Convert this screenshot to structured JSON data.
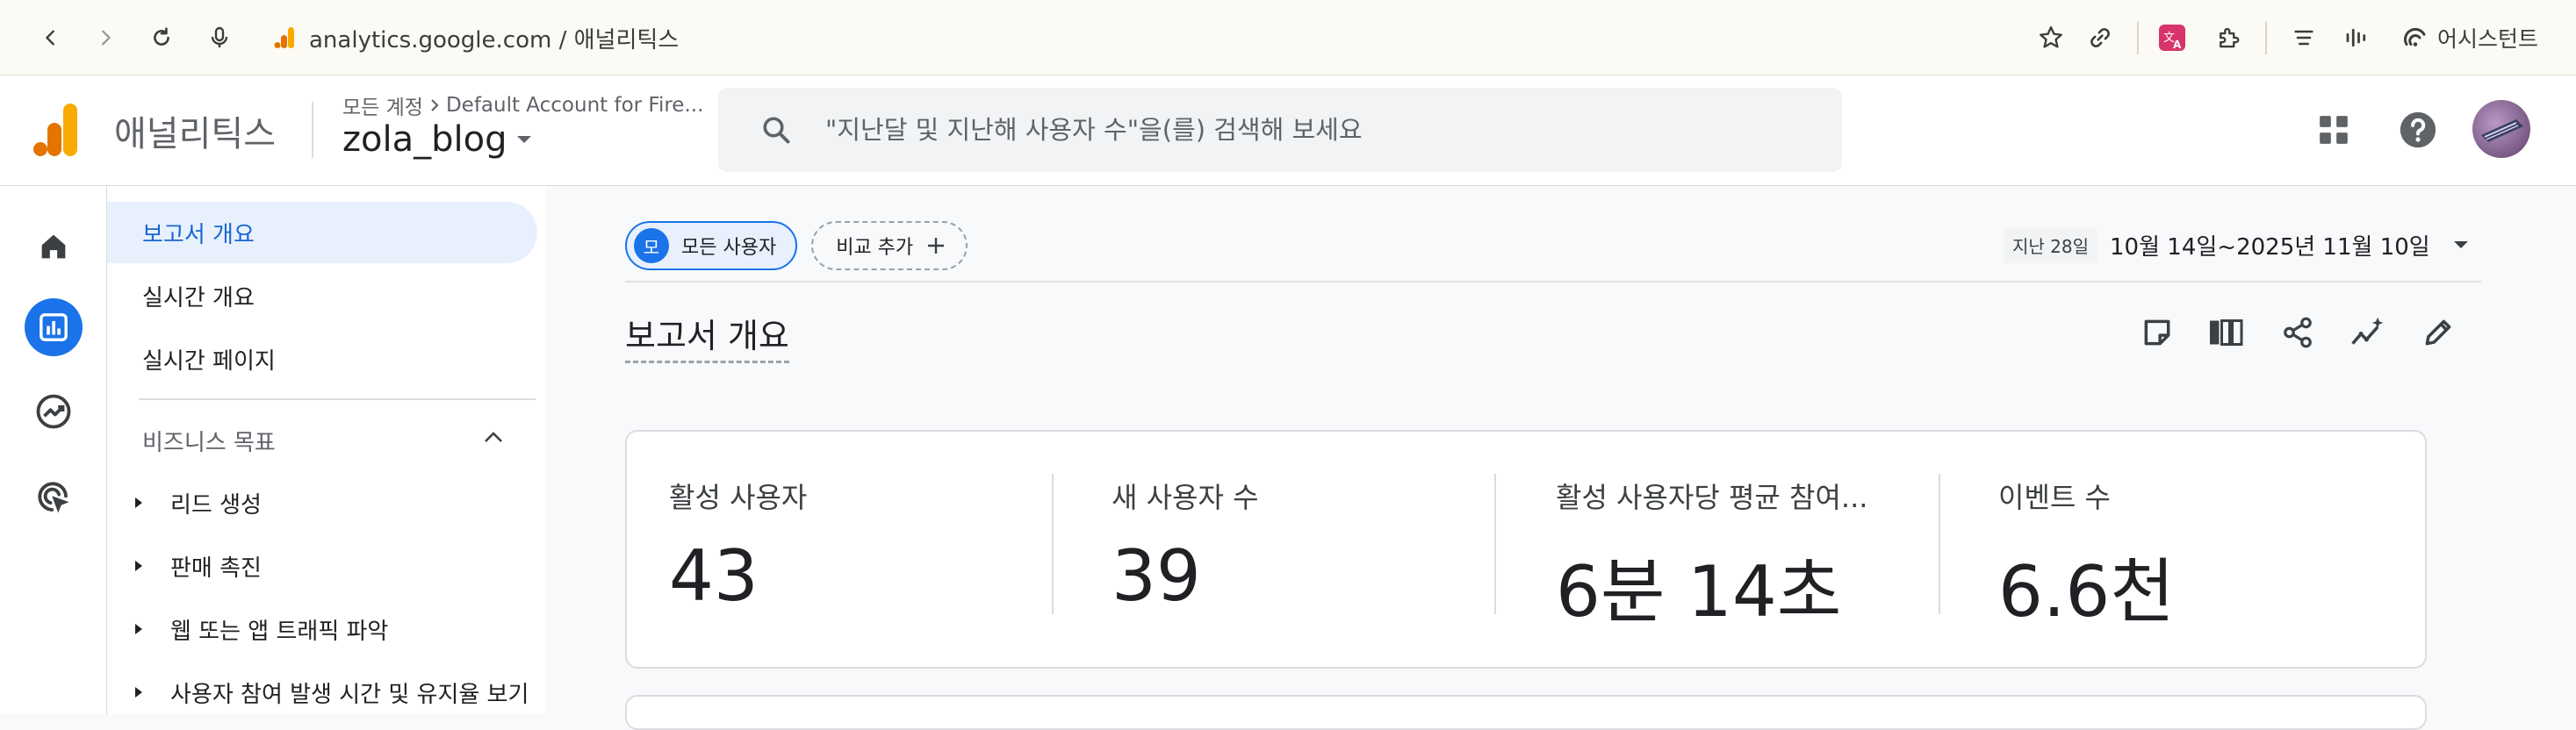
{
  "browser": {
    "url": "analytics.google.com / 애널리틱스",
    "assistant_label": "어시스턴트"
  },
  "header": {
    "brand": "애널리틱스",
    "account_crumb": "모든 계정",
    "account_name": "Default Account for Fire...",
    "property": "zola_blog",
    "search_placeholder": "\"지난달 및 지난해 사용자 수\"을(를) 검색해 보세요"
  },
  "sidenav": {
    "items": [
      {
        "label": "보고서 개요",
        "active": true
      },
      {
        "label": "실시간 개요"
      },
      {
        "label": "실시간 페이지"
      }
    ],
    "section": "비즈니스 목표",
    "subitems": [
      {
        "label": "리드 생성"
      },
      {
        "label": "판매 촉진"
      },
      {
        "label": "웹 또는 앱 트래픽 파악"
      },
      {
        "label": "사용자 참여 발생 시간 및 유지율 보기"
      }
    ]
  },
  "main": {
    "segment_chip": {
      "avatar": "모",
      "label": "모든 사용자"
    },
    "compare_chip": "비교 추가",
    "date_prefix": "지난 28일",
    "date_range": "10월 14일~2025년 11월 10일",
    "page_title": "보고서 개요",
    "metrics": [
      {
        "label": "활성 사용자",
        "value": "43"
      },
      {
        "label": "새 사용자 수",
        "value": "39"
      },
      {
        "label": "활성 사용자당 평균 참여...",
        "value": "6분 14초"
      },
      {
        "label": "이벤트 수",
        "value": "6.6천"
      }
    ]
  },
  "colors": {
    "accent": "#1a73e8",
    "active_nav_bg": "#e8f0fe",
    "logo_orange": "#f9ab00",
    "logo_dark_orange": "#e37400"
  },
  "icons": [
    "back-icon",
    "forward-icon",
    "reload-icon",
    "mic-icon",
    "star-icon",
    "link-icon",
    "translate-icon",
    "extension-icon",
    "reading-list-icon",
    "audio-icon",
    "assistant-icon",
    "search-icon",
    "apps-grid-icon",
    "help-icon",
    "home-icon",
    "reports-icon",
    "explore-icon",
    "advertising-icon",
    "chevron-up-icon",
    "plus-icon",
    "caret-down-icon",
    "note-icon",
    "compare-columns-icon",
    "share-icon",
    "insights-icon",
    "edit-icon"
  ]
}
